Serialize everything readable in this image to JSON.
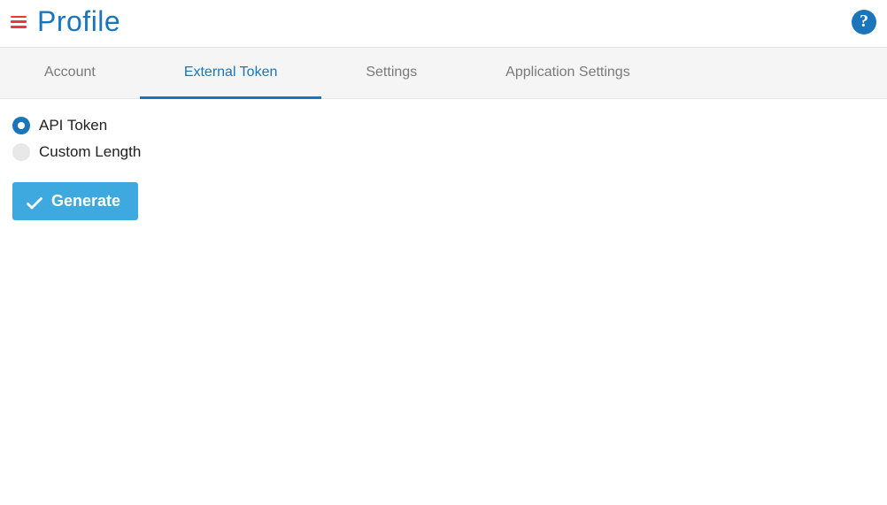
{
  "header": {
    "title": "Profile"
  },
  "tabs": [
    {
      "label": "Account",
      "active": false
    },
    {
      "label": "External Token",
      "active": true
    },
    {
      "label": "Settings",
      "active": false
    },
    {
      "label": "Application Settings",
      "active": false
    }
  ],
  "radios": {
    "api_token": {
      "label": "API Token",
      "selected": true
    },
    "custom_length": {
      "label": "Custom Length",
      "selected": false
    }
  },
  "buttons": {
    "generate": "Generate"
  }
}
